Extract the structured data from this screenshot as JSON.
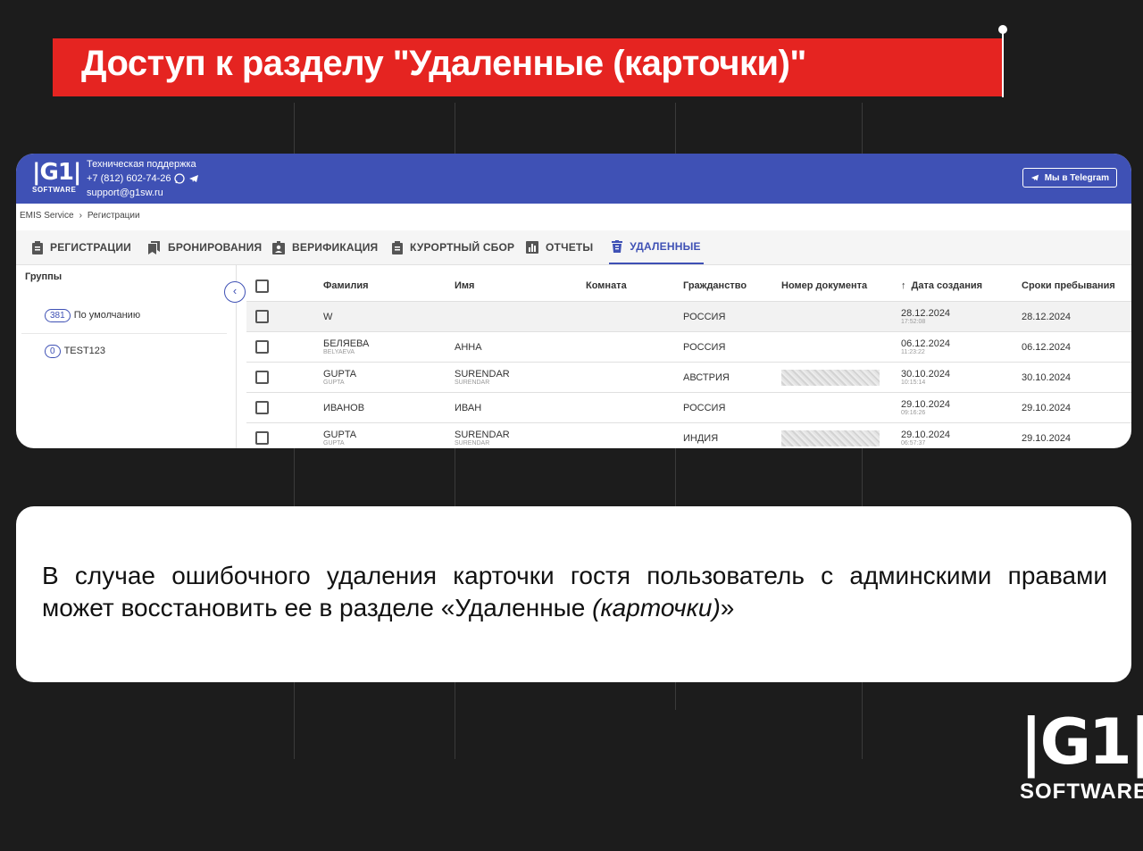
{
  "slide": {
    "title": "Доступ к разделу \"Удаленные (карточки)\"",
    "description_line1": "В случае ошибочного удаления карточки гостя пользователь с админскими правами",
    "description_line2_start": "может восстановить ее в разделе «Удаленные ",
    "description_line2_italic": "(карточки)",
    "description_line2_end": "»",
    "footer_logo_text": "|G1|",
    "footer_logo_sub": "SOFTWARE",
    "accent_color": "#e52421"
  },
  "app": {
    "brand_color": "#3f51b5",
    "logo_text": "|G1|",
    "logo_sub": "SOFTWARE",
    "support_title": "Техническая поддержка",
    "support_phone": "+7 (812) 602-74-26",
    "support_email": "support@g1sw.ru",
    "telegram_button": "Мы в Telegram",
    "breadcrumb": [
      "EMIS Service",
      "›",
      "Регистрации"
    ],
    "tabs": [
      {
        "label": "РЕГИСТРАЦИИ",
        "icon": "clipboard-icon"
      },
      {
        "label": "БРОНИРОВАНИЯ",
        "icon": "bookmark-icon"
      },
      {
        "label": "ВЕРИФИКАЦИЯ",
        "icon": "id-badge-icon"
      },
      {
        "label": "КУРОРТНЫЙ СБОР",
        "icon": "clipboard-icon"
      },
      {
        "label": "ОТЧЕТЫ",
        "icon": "bar-chart-icon"
      },
      {
        "label": "УДАЛЕННЫЕ",
        "icon": "trash-icon",
        "active": true
      }
    ],
    "groups_header": "Группы",
    "groups": [
      {
        "count": "381",
        "name": "По умолчанию"
      },
      {
        "count": "0",
        "name": "TEST123"
      }
    ],
    "columns": [
      "Фамилия",
      "Имя",
      "Комната",
      "Гражданство",
      "Номер документа",
      "Дата создания",
      "Сроки пребывания"
    ],
    "sort_indicator": "↑",
    "rows": [
      {
        "last": "W",
        "last_sub": "",
        "first": "",
        "first_sub": "",
        "room": "",
        "country": "РОССИЯ",
        "doc_hidden": false,
        "date": "28.12.2024",
        "time": "17:52:08",
        "stay": "28.12.2024"
      },
      {
        "last": "БЕЛЯЕВА",
        "last_sub": "BELYAEVA",
        "first": "АННА",
        "first_sub": "",
        "room": "",
        "country": "РОССИЯ",
        "doc_hidden": false,
        "date": "06.12.2024",
        "time": "11:23:22",
        "stay": "06.12.2024"
      },
      {
        "last": "GUPTA",
        "last_sub": "GUPTA",
        "first": "SURENDAR",
        "first_sub": "SURENDAR",
        "room": "",
        "country": "АВСТРИЯ",
        "doc_hidden": true,
        "date": "30.10.2024",
        "time": "10:15:14",
        "stay": "30.10.2024"
      },
      {
        "last": "ИВАНОВ",
        "last_sub": "",
        "first": "ИВАН",
        "first_sub": "",
        "room": "",
        "country": "РОССИЯ",
        "doc_hidden": false,
        "date": "29.10.2024",
        "time": "09:16:26",
        "stay": "29.10.2024"
      },
      {
        "last": "GUPTA",
        "last_sub": "GUPTA",
        "first": "SURENDAR",
        "first_sub": "SURENDAR",
        "room": "",
        "country": "ИНДИЯ",
        "doc_hidden": true,
        "date": "29.10.2024",
        "time": "06:57:37",
        "stay": "29.10.2024"
      }
    ]
  }
}
